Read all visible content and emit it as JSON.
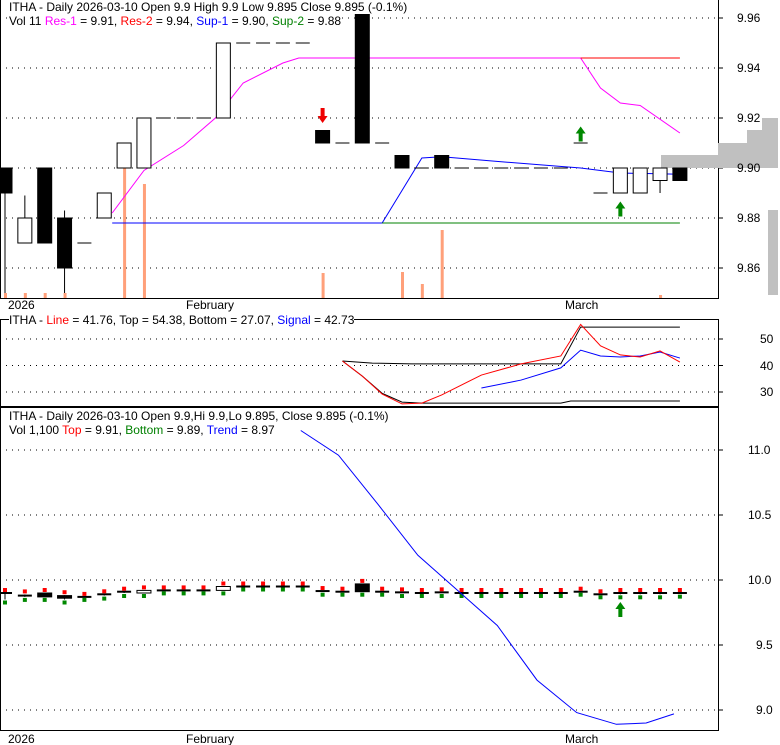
{
  "panel1": {
    "title": "ITHA - Daily 2026-03-10 Open 9.9  High 9.9  Low 9.895  Close 9.895 (-0.1%)",
    "vol": "Vol 11",
    "res1_label": "Res-1",
    "res1_value": " = 9.91, ",
    "res2_label": "Res-2",
    "res2_value": " = 9.94, ",
    "sup1_label": "Sup-1",
    "sup1_value": " = 9.90, ",
    "sup2_label": "Sup-2",
    "sup2_value": " = 9.88",
    "yticks": [
      "9.96",
      "9.94",
      "9.92",
      "9.90",
      "9.88",
      "9.86"
    ]
  },
  "panel2": {
    "prefix": "ITHA - ",
    "line_label": "Line",
    "line_value": " = 41.76, Top = 54.38, Bottom = 27.07, ",
    "signal_label": "Signal",
    "signal_value": " = 42.73",
    "yticks": [
      "50",
      "40",
      "30"
    ]
  },
  "panel3": {
    "title": "ITHA - Daily 2026-03-10 Open 9.9,Hi 9.9,Lo 9.895, Close 9.895 (-0.1%)",
    "vol": "Vol 1,100 ",
    "top_label": "Top",
    "top_value": " = 9.91, ",
    "bottom_label": "Bottom",
    "bottom_value": " = 9.89, ",
    "trend_label": "Trend",
    "trend_value": " = 8.97",
    "yticks": [
      "11.0",
      "10.5",
      "10.0",
      "9.5",
      "9.0"
    ]
  },
  "xlabels": [
    "2026",
    "February",
    "March"
  ],
  "colors": {
    "res1": "#ff00ff",
    "res2": "#ff0000",
    "sup1": "#0000ff",
    "sup2": "#008000",
    "volume": "#ffa07a",
    "profile": "#c0c0c0"
  },
  "chart_data": {
    "type": "candlestick",
    "candles": [
      [
        0,
        9.9,
        9.9,
        9.85,
        9.89
      ],
      [
        1,
        9.87,
        9.889,
        9.87,
        9.88
      ],
      [
        2,
        9.9,
        9.9,
        9.87,
        9.87
      ],
      [
        3,
        9.88,
        9.883,
        9.85,
        9.86
      ],
      [
        4,
        9.87,
        9.87,
        9.87,
        9.87
      ],
      [
        5,
        9.88,
        9.89,
        9.88,
        9.89
      ],
      [
        6,
        9.9,
        9.91,
        9.9,
        9.91
      ],
      [
        7,
        9.9,
        9.92,
        9.9,
        9.92
      ],
      [
        8,
        9.92,
        9.92,
        9.92,
        9.92
      ],
      [
        9,
        9.92,
        9.92,
        9.92,
        9.92
      ],
      [
        10,
        9.92,
        9.92,
        9.92,
        9.92
      ],
      [
        11,
        9.92,
        9.95,
        9.92,
        9.95
      ],
      [
        12,
        9.95,
        9.95,
        9.95,
        9.95
      ],
      [
        13,
        9.95,
        9.95,
        9.95,
        9.95
      ],
      [
        14,
        9.95,
        9.95,
        9.95,
        9.95
      ],
      [
        15,
        9.95,
        9.95,
        9.95,
        9.95
      ],
      [
        16,
        9.915,
        9.915,
        9.91,
        9.91
      ],
      [
        17,
        9.91,
        9.91,
        9.91,
        9.91
      ],
      [
        18,
        9.97,
        9.97,
        9.91,
        9.91
      ],
      [
        19,
        9.91,
        9.91,
        9.91,
        9.91
      ],
      [
        20,
        9.905,
        9.905,
        9.9,
        9.9
      ],
      [
        21,
        9.9,
        9.9,
        9.9,
        9.9
      ],
      [
        22,
        9.905,
        9.905,
        9.9,
        9.9
      ],
      [
        23,
        9.9,
        9.9,
        9.9,
        9.9
      ],
      [
        24,
        9.9,
        9.9,
        9.9,
        9.9
      ],
      [
        25,
        9.9,
        9.9,
        9.9,
        9.9
      ],
      [
        26,
        9.9,
        9.9,
        9.9,
        9.9
      ],
      [
        27,
        9.9,
        9.9,
        9.9,
        9.9
      ],
      [
        28,
        9.9,
        9.9,
        9.9,
        9.9
      ],
      [
        29,
        9.91,
        9.91,
        9.91,
        9.91
      ],
      [
        30,
        9.89,
        9.89,
        9.89,
        9.89
      ],
      [
        31,
        9.89,
        9.9,
        9.89,
        9.9
      ],
      [
        32,
        9.89,
        9.9,
        9.89,
        9.9
      ],
      [
        33,
        9.895,
        9.9,
        9.89,
        9.9
      ],
      [
        34,
        9.9,
        9.9,
        9.895,
        9.895
      ]
    ],
    "volume": [
      [
        0,
        5
      ],
      [
        1,
        5
      ],
      [
        2,
        5
      ],
      [
        3,
        5
      ],
      [
        6,
        130
      ],
      [
        7,
        114
      ],
      [
        16,
        25
      ],
      [
        20,
        26
      ],
      [
        21,
        14
      ],
      [
        22,
        68
      ],
      [
        33,
        3
      ]
    ],
    "volume_max": 140,
    "res1": [
      [
        5.4,
        9.882
      ],
      [
        7,
        9.899
      ],
      [
        9,
        9.909
      ],
      [
        10.6,
        9.92
      ],
      [
        12,
        9.934
      ],
      [
        14,
        9.942
      ],
      [
        14.8,
        9.944
      ],
      [
        29,
        9.944
      ],
      [
        30,
        9.932
      ],
      [
        31,
        9.926
      ],
      [
        32,
        9.925
      ],
      [
        34,
        9.914
      ]
    ],
    "res2": [
      [
        29,
        9.944
      ],
      [
        34,
        9.944
      ]
    ],
    "sup1": [
      [
        5.4,
        9.878
      ],
      [
        19,
        9.878
      ],
      [
        21,
        9.904
      ],
      [
        22,
        9.9045
      ],
      [
        25,
        9.9025
      ],
      [
        29,
        9.9
      ],
      [
        31,
        9.898
      ],
      [
        34,
        9.8975
      ]
    ],
    "sup2": [
      [
        19,
        9.878
      ],
      [
        34,
        9.878
      ]
    ],
    "down_arrows": [
      16
    ],
    "up_arrows": [
      [
        29,
        9.915
      ],
      [
        31,
        9.885
      ]
    ],
    "price_range": [
      9.848,
      9.973
    ],
    "osc": {
      "line": [
        [
          17,
          41.7
        ],
        [
          18,
          36.0
        ],
        [
          19,
          29.2
        ],
        [
          20,
          25.5
        ],
        [
          21,
          25.8
        ],
        [
          22,
          28.9
        ],
        [
          24,
          36.4
        ],
        [
          26,
          40.6
        ],
        [
          28,
          43.6
        ],
        [
          29,
          55.5
        ],
        [
          30,
          47.4
        ],
        [
          31,
          44.0
        ],
        [
          32,
          43.2
        ],
        [
          33,
          45.5
        ],
        [
          34,
          41.3
        ]
      ],
      "signal": [
        [
          24,
          31.5
        ],
        [
          26,
          34.5
        ],
        [
          28,
          39.1
        ],
        [
          29,
          45.8
        ],
        [
          30,
          43.6
        ],
        [
          31,
          43.2
        ],
        [
          32,
          43.6
        ],
        [
          33,
          45.1
        ],
        [
          34,
          42.8
        ]
      ],
      "top": [
        [
          17,
          41.7
        ],
        [
          18.5,
          40.9
        ],
        [
          20.5,
          40.6
        ],
        [
          28,
          40.6
        ],
        [
          29,
          54.5
        ],
        [
          34,
          54.5
        ]
      ],
      "bottom": [
        [
          17,
          41.7
        ],
        [
          18,
          36.0
        ],
        [
          19,
          29.5
        ],
        [
          20,
          26.2
        ],
        [
          21,
          25.8
        ],
        [
          28,
          25.8
        ],
        [
          28.5,
          26.6
        ],
        [
          34,
          26.6
        ]
      ],
      "range": [
        23,
        58
      ]
    },
    "trend": [
      [
        14.9,
        11.15
      ],
      [
        16.8,
        10.96
      ],
      [
        18.8,
        10.58
      ],
      [
        20.8,
        10.19
      ],
      [
        22.8,
        9.92
      ],
      [
        24.8,
        9.65
      ],
      [
        26.8,
        9.23
      ],
      [
        28.8,
        8.98
      ],
      [
        30.8,
        8.89
      ],
      [
        32.3,
        8.9
      ],
      [
        33.7,
        8.97
      ]
    ],
    "trend_range": [
      8.8,
      11.3
    ],
    "trend_up_arrows": [
      31
    ]
  }
}
